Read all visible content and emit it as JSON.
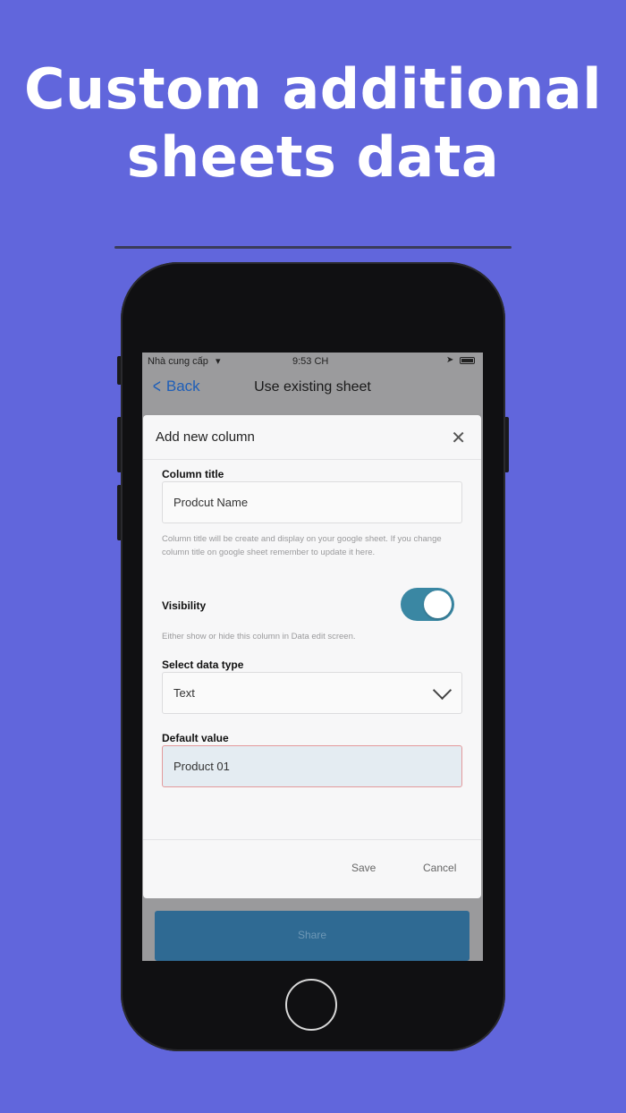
{
  "headline": {
    "line1": "Custom additional",
    "line2": "sheets data"
  },
  "status_bar": {
    "carrier": "Nhà cung cấp",
    "time": "9:53 CH"
  },
  "nav": {
    "back_label": "Back",
    "title": "Use existing sheet"
  },
  "modal": {
    "title": "Add new column",
    "column_title": {
      "label": "Column title",
      "value": "Prodcut Name",
      "hint": "Column title will be create and display on your google sheet. If you change column title on google sheet remember to update it here."
    },
    "visibility": {
      "label": "Visibility",
      "enabled": true,
      "hint": "Either show or hide this column in Data edit screen."
    },
    "data_type": {
      "label": "Select data type",
      "selected": "Text"
    },
    "default_value": {
      "label": "Default value",
      "value": "Product 01"
    },
    "save_label": "Save",
    "cancel_label": "Cancel"
  },
  "share_label": "Share",
  "colors": {
    "background": "#6166dc",
    "toggle_on": "#3a87a3",
    "share_button": "#2f6a93",
    "back_link": "#1f5fb8"
  }
}
